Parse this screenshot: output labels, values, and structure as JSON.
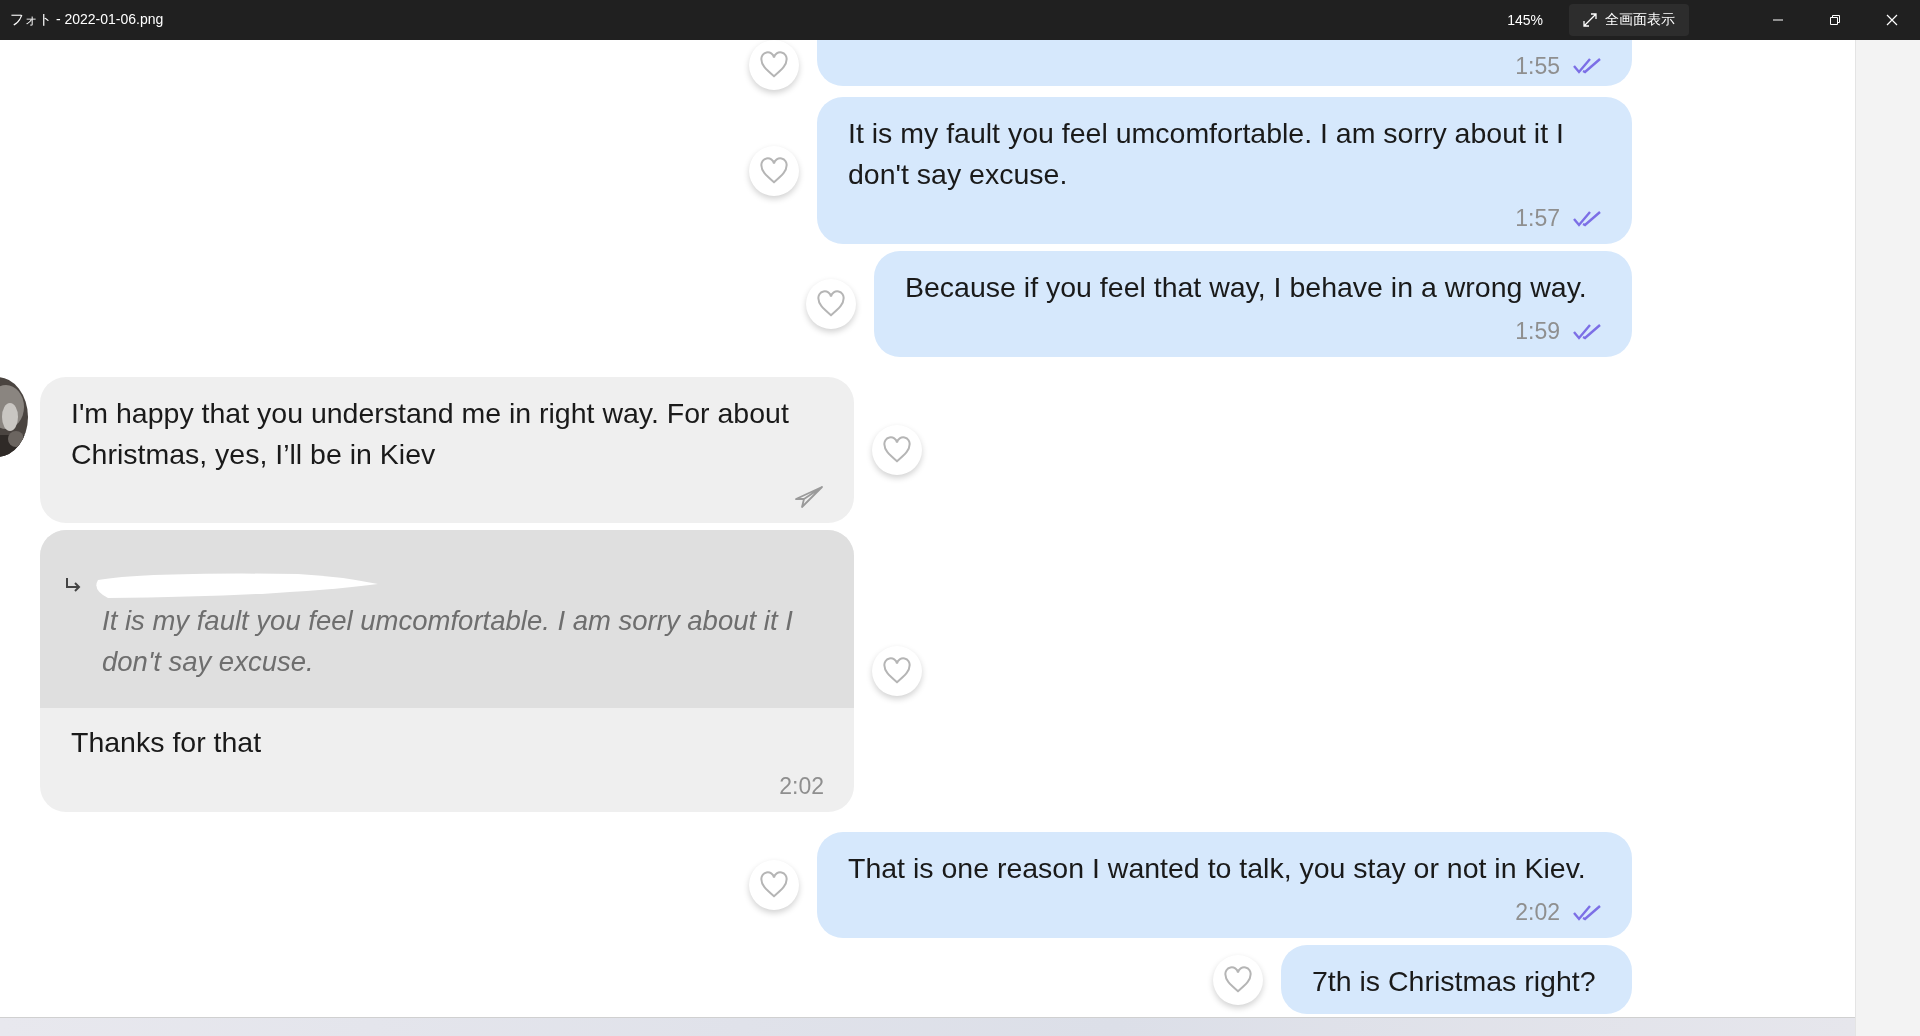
{
  "window": {
    "title": "フォト - 2022-01-06.png",
    "zoom": "145%",
    "fullscreen_button": "全画面表示"
  },
  "messages": [
    {
      "kind": "sent",
      "time": "1:55",
      "read": true
    },
    {
      "kind": "sent",
      "text": "It is my fault you feel umcomfortable. I am sorry about it I don't say excuse.",
      "time": "1:57",
      "read": true
    },
    {
      "kind": "sent",
      "text": "Because if you feel that way, I behave in a wrong way.",
      "time": "1:59",
      "read": true
    },
    {
      "kind": "received",
      "text": "I'm happy that you understand me in right way. For about Christmas, yes, I’ll be in Kiev",
      "avatar": true,
      "reply_action": true
    },
    {
      "kind": "received",
      "quote": "It is my fault you feel umcomfortable. I am sorry about it I don't say excuse.",
      "text": "Thanks for that",
      "time": "2:02"
    },
    {
      "kind": "sent",
      "text": "That is one reason I wanted to talk, you stay or not in Kiev.",
      "time": "2:02",
      "read": true
    },
    {
      "kind": "sent",
      "text": "7th is Christmas right?"
    }
  ]
}
